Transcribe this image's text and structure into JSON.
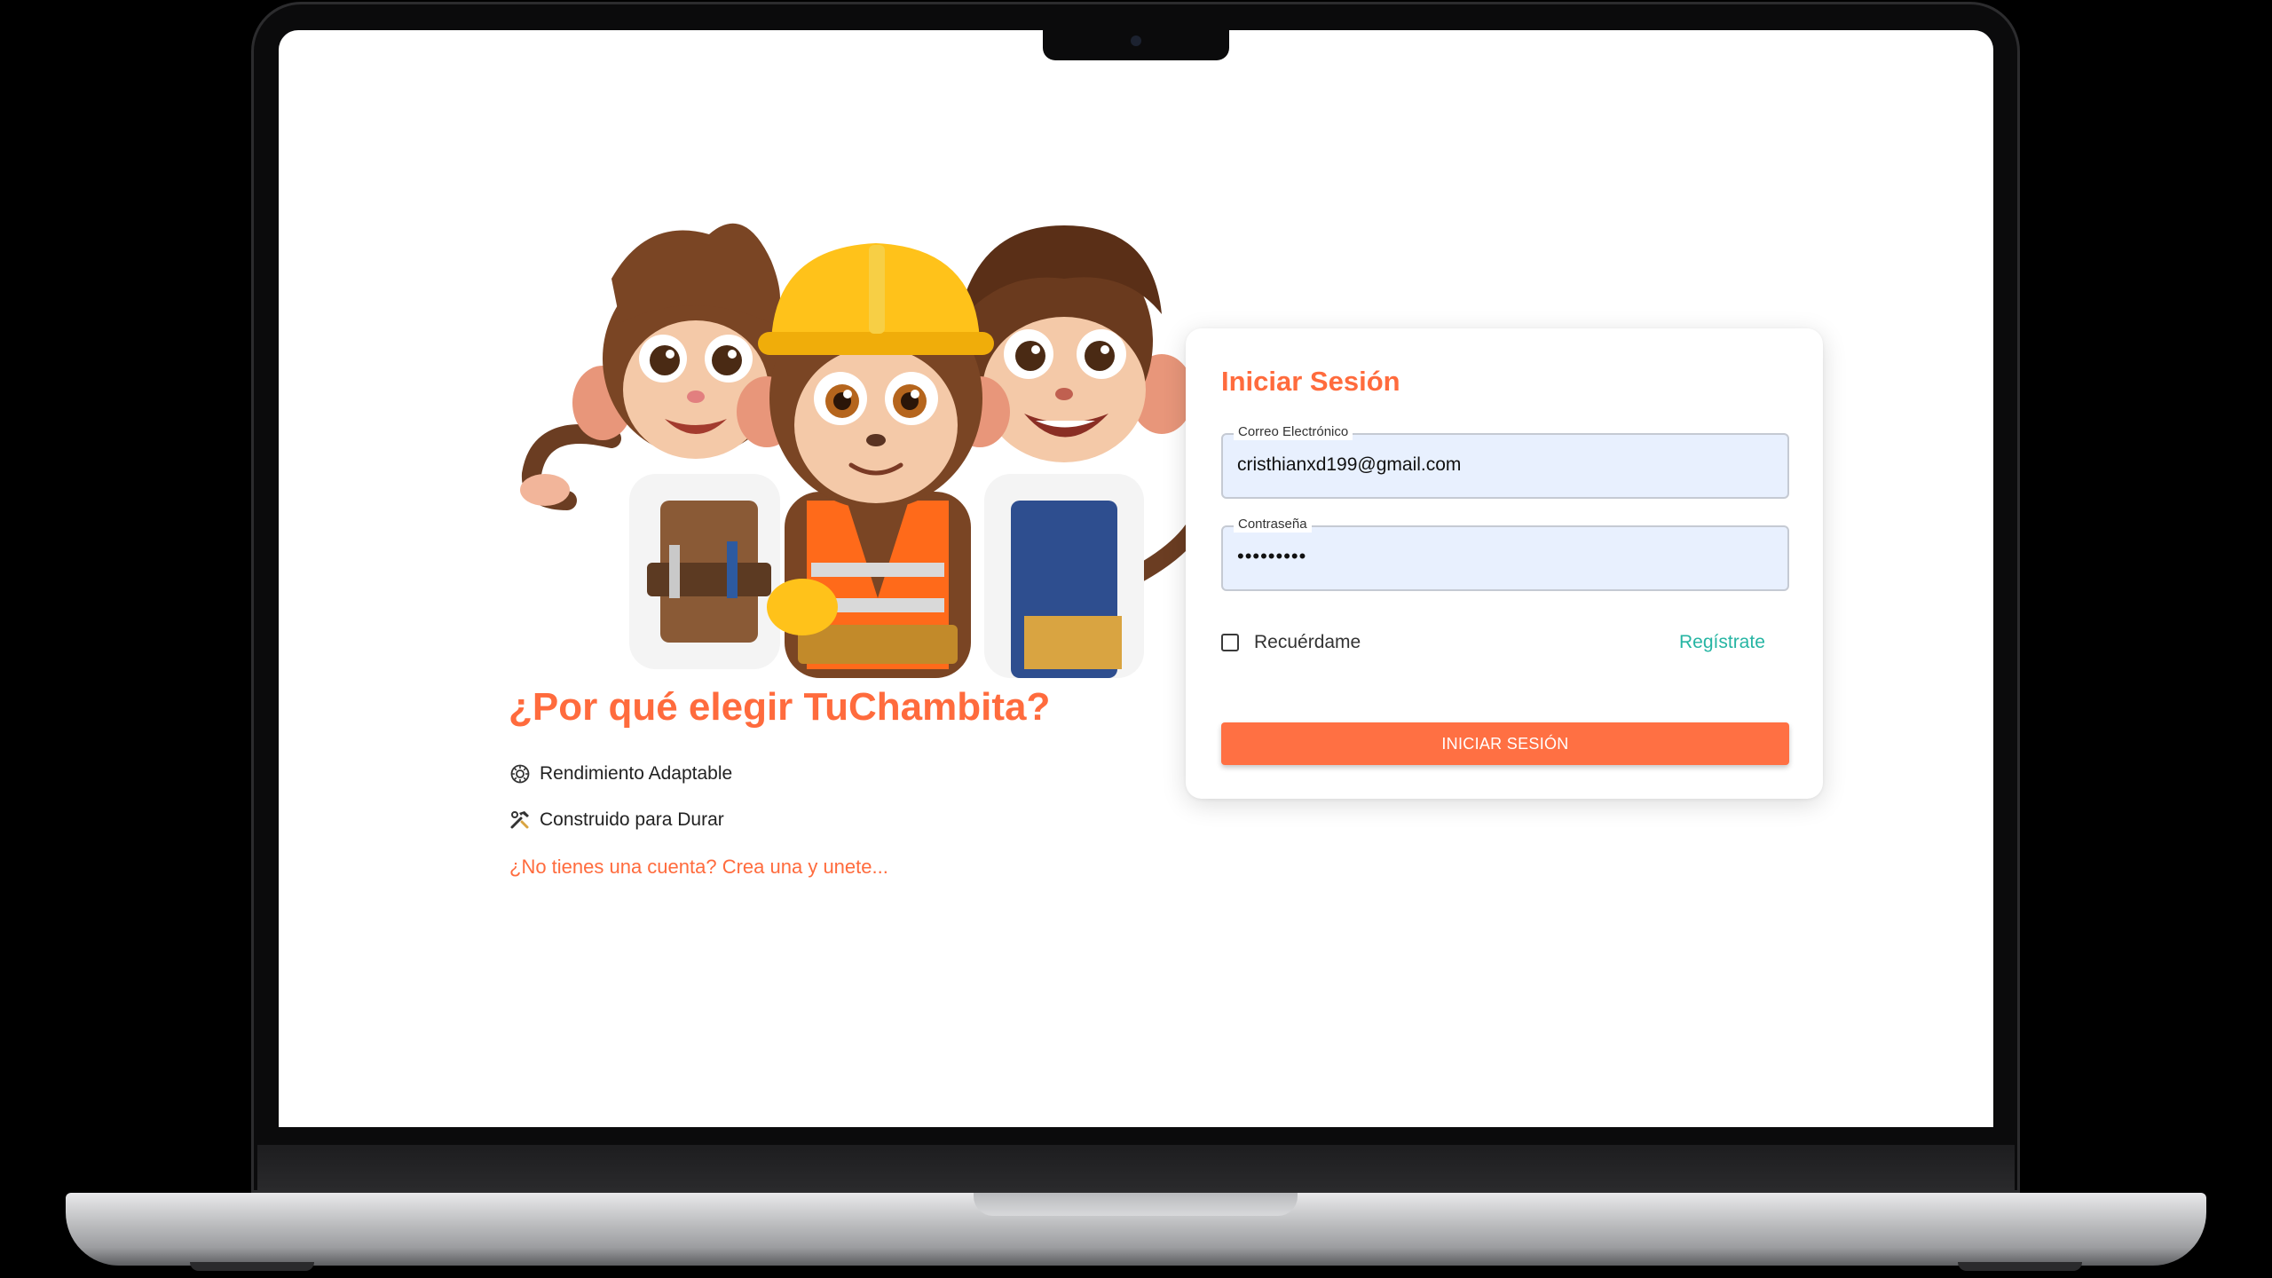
{
  "colors": {
    "accent": "#ff6b3d",
    "button": "#ff7043",
    "link_teal": "#26b5a3",
    "input_bg": "#e8f0fe"
  },
  "hero": {
    "image": "three-cartoon-monkey-workers-illustration"
  },
  "why": {
    "title": "¿Por qué elegir TuChambita?",
    "features": [
      {
        "icon": "gear-icon",
        "label": "Rendimiento Adaptable"
      },
      {
        "icon": "tools-icon",
        "label": "Construido para Durar"
      }
    ],
    "signup_link": "¿No tienes una cuenta? Crea una y unete..."
  },
  "login": {
    "title": "Iniciar Sesión",
    "email": {
      "label": "Correo Electrónico",
      "value": "cristhianxd199@gmail.com"
    },
    "password": {
      "label": "Contraseña",
      "value": "•••••••••"
    },
    "remember_label": "Recuérdame",
    "remember_checked": false,
    "register_link": "Regístrate",
    "submit_label": "INICIAR SESIÓN"
  }
}
